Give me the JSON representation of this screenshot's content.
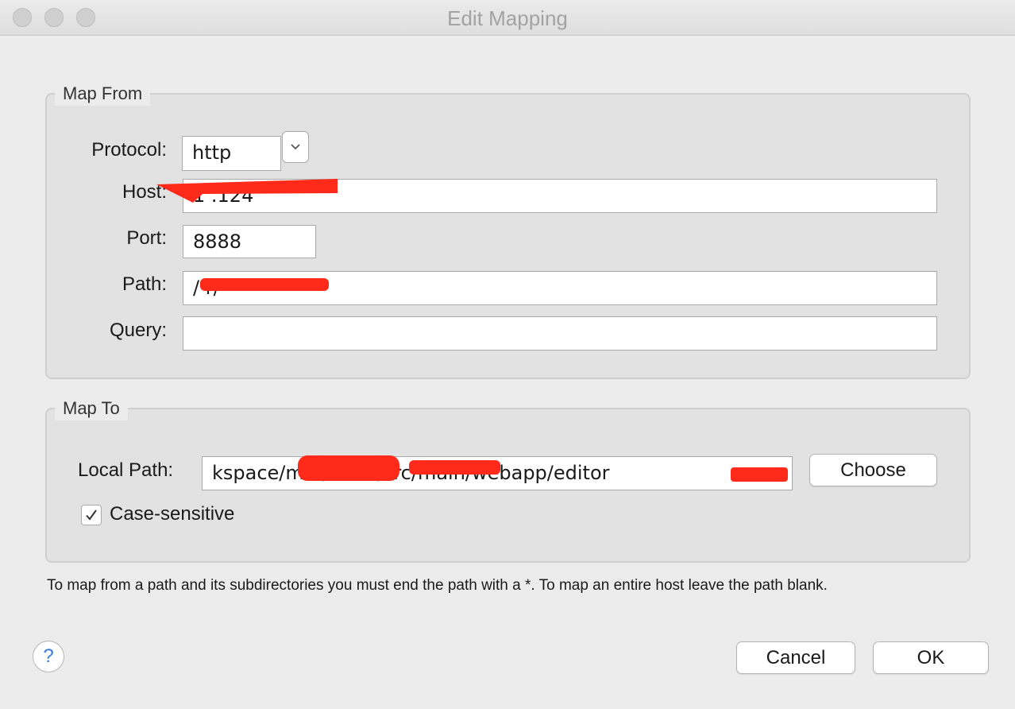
{
  "window": {
    "title": "Edit Mapping"
  },
  "map_from": {
    "legend": "Map From",
    "protocol_label": "Protocol:",
    "protocol_value": "http",
    "host_label": "Host:",
    "host_value": "1          .124",
    "port_label": "Port:",
    "port_value": "8888",
    "path_label": "Path:",
    "path_value": "/          r/*",
    "query_label": "Query:",
    "query_value": ""
  },
  "map_to": {
    "legend": "Map To",
    "local_path_label": "Local Path:",
    "local_path_value": "kspace/m         b/m         eb/src/main/webapp/editor",
    "choose_label": "Choose",
    "case_sensitive_label": "Case-sensitive",
    "case_sensitive_checked": true
  },
  "hint": "To map from a path and its subdirectories you must end the path with a *. To map an entire host leave the path blank.",
  "buttons": {
    "cancel": "Cancel",
    "ok": "OK",
    "help": "?"
  },
  "colors": {
    "redaction": "#ff2a1a",
    "help_accent": "#3a7bd5"
  }
}
